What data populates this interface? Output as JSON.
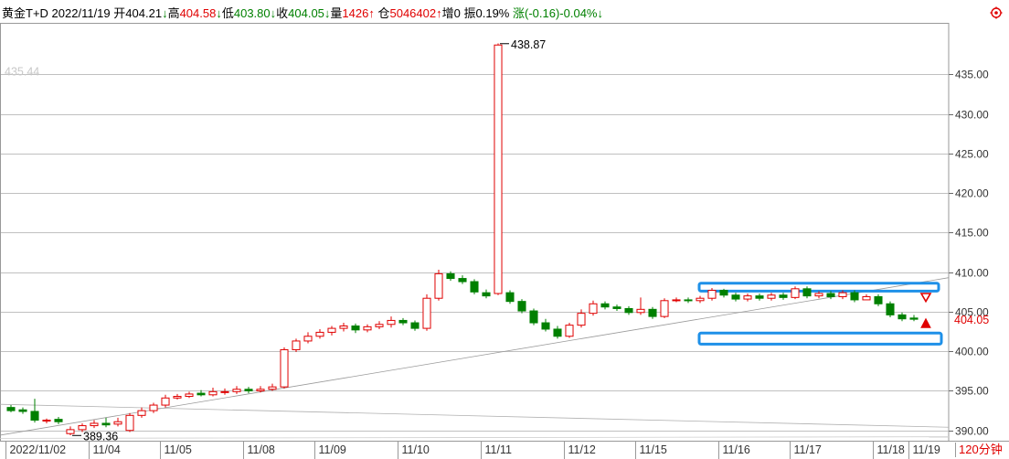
{
  "header": {
    "symbol": "黄金T+D",
    "date": "2022/11/19",
    "open_label": "开",
    "open": "404.21",
    "open_arrow": "↓",
    "high_label": "高",
    "high": "404.58",
    "high_arrow": "↓",
    "low_label": "低",
    "low": "403.80",
    "low_arrow": "↓",
    "close_label": "收",
    "close": "404.05",
    "close_arrow": "↓",
    "vol_label": "量",
    "vol": "1426",
    "vol_arrow": "↑",
    "oi_label": "仓",
    "oi": "5046402",
    "oi_arrow": "↑",
    "inc_label": "增",
    "inc": "0",
    "amp_label": "振",
    "amp": "0.19%",
    "chg_label": "涨",
    "chg": "(-0.16)-0.04%",
    "chg_arrow": "↓"
  },
  "period": "120分钟",
  "colors": {
    "up": "#e00000",
    "down": "#008000",
    "box": "#1e90e8",
    "grid": "#c0c0c0"
  },
  "icons": {
    "settings": "gear-icon",
    "sell_marker": "down-arrow-icon",
    "buy_marker": "up-arrow-icon"
  },
  "chart_data": {
    "type": "candlestick",
    "ylim": [
      388.7,
      441.5
    ],
    "y_ticks": [
      "390.00",
      "395.00",
      "400.00",
      "405.00",
      "410.00",
      "415.00",
      "420.00",
      "425.00",
      "430.00",
      "435.00"
    ],
    "last_price": "404.05",
    "view_high": "435.44",
    "x_labels": [
      "2022/11/02",
      "11/04",
      "11/05",
      "11/08",
      "11/09",
      "11/10",
      "11/11",
      "11/12",
      "11/15",
      "11/16",
      "11/17",
      "11/18",
      "11/19"
    ],
    "annotations": [
      {
        "text": "438.87",
        "at_index": 40
      },
      {
        "text": "389.36",
        "at_index": 5
      }
    ],
    "candles": [
      [
        392.9,
        392.5,
        393.2,
        392.3
      ],
      [
        392.6,
        392.4,
        392.9,
        392.1
      ],
      [
        392.4,
        391.3,
        394.0,
        391.0
      ],
      [
        391.2,
        391.3,
        391.5,
        390.9
      ],
      [
        391.4,
        391.1,
        391.7,
        390.8
      ],
      [
        389.6,
        390.1,
        390.5,
        389.4
      ],
      [
        390.1,
        390.6,
        390.9,
        389.8
      ],
      [
        390.6,
        390.9,
        391.3,
        390.3
      ],
      [
        390.9,
        390.7,
        391.6,
        390.4
      ],
      [
        390.8,
        391.1,
        391.6,
        390.5
      ],
      [
        390.0,
        391.9,
        392.2,
        389.8
      ],
      [
        391.9,
        392.5,
        392.9,
        391.6
      ],
      [
        392.5,
        393.2,
        393.5,
        392.2
      ],
      [
        393.2,
        394.1,
        394.5,
        392.9
      ],
      [
        394.1,
        394.3,
        394.6,
        393.9
      ],
      [
        394.3,
        394.6,
        394.9,
        394.1
      ],
      [
        394.7,
        394.5,
        395.1,
        394.3
      ],
      [
        394.5,
        394.9,
        395.4,
        394.3
      ],
      [
        394.9,
        394.9,
        395.3,
        394.5
      ],
      [
        394.9,
        395.2,
        395.6,
        394.6
      ],
      [
        395.2,
        395.0,
        395.5,
        394.7
      ],
      [
        395.0,
        395.2,
        395.6,
        394.8
      ],
      [
        395.2,
        395.5,
        395.9,
        395.0
      ],
      [
        395.5,
        400.2,
        400.5,
        395.3
      ],
      [
        400.2,
        401.3,
        401.6,
        399.9
      ],
      [
        401.3,
        401.9,
        402.4,
        401.0
      ],
      [
        401.9,
        402.4,
        402.8,
        401.6
      ],
      [
        402.4,
        402.9,
        403.2,
        402.0
      ],
      [
        402.9,
        403.2,
        403.6,
        402.5
      ],
      [
        403.2,
        402.7,
        403.5,
        402.3
      ],
      [
        402.7,
        403.1,
        403.4,
        402.4
      ],
      [
        403.1,
        403.4,
        403.8,
        402.8
      ],
      [
        403.4,
        403.9,
        404.4,
        403.0
      ],
      [
        403.9,
        403.6,
        404.2,
        403.3
      ],
      [
        403.6,
        402.9,
        403.9,
        402.6
      ],
      [
        402.9,
        406.7,
        407.2,
        402.6
      ],
      [
        406.7,
        409.8,
        410.3,
        406.4
      ],
      [
        409.8,
        409.2,
        410.1,
        408.9
      ],
      [
        409.2,
        408.8,
        409.6,
        408.5
      ],
      [
        408.8,
        407.5,
        409.1,
        407.2
      ],
      [
        407.4,
        407.0,
        407.8,
        406.7
      ],
      [
        407.3,
        438.7,
        438.9,
        407.1
      ],
      [
        407.4,
        406.3,
        407.7,
        406.0
      ],
      [
        406.3,
        405.1,
        406.6,
        404.8
      ],
      [
        405.1,
        403.6,
        405.4,
        403.3
      ],
      [
        403.6,
        402.8,
        404.1,
        402.5
      ],
      [
        402.8,
        401.9,
        403.2,
        401.6
      ],
      [
        401.9,
        403.3,
        403.6,
        401.7
      ],
      [
        403.3,
        404.8,
        405.3,
        403.0
      ],
      [
        404.8,
        406.0,
        406.4,
        404.5
      ],
      [
        406.0,
        405.6,
        406.3,
        405.3
      ],
      [
        405.6,
        405.4,
        405.9,
        405.1
      ],
      [
        405.4,
        404.9,
        405.7,
        404.6
      ],
      [
        404.9,
        405.3,
        406.8,
        404.6
      ],
      [
        405.3,
        404.4,
        405.6,
        404.1
      ],
      [
        404.4,
        406.4,
        406.7,
        404.2
      ],
      [
        406.4,
        406.5,
        406.8,
        406.2
      ],
      [
        406.5,
        406.4,
        406.8,
        406.1
      ],
      [
        406.4,
        406.7,
        407.0,
        406.1
      ],
      [
        406.7,
        407.7,
        408.0,
        406.4
      ],
      [
        407.7,
        407.1,
        407.9,
        406.8
      ],
      [
        407.1,
        406.6,
        407.4,
        406.3
      ],
      [
        406.6,
        407.0,
        407.3,
        406.3
      ],
      [
        407.0,
        406.7,
        407.3,
        406.4
      ],
      [
        406.7,
        407.1,
        407.4,
        406.4
      ],
      [
        407.1,
        406.8,
        407.4,
        406.5
      ],
      [
        406.8,
        407.9,
        408.2,
        406.6
      ],
      [
        407.9,
        407.0,
        408.2,
        406.7
      ],
      [
        407.0,
        407.3,
        407.6,
        406.7
      ],
      [
        407.3,
        406.9,
        407.6,
        406.6
      ],
      [
        406.9,
        407.4,
        407.7,
        406.6
      ],
      [
        407.4,
        406.5,
        407.7,
        406.2
      ],
      [
        406.5,
        406.9,
        407.2,
        406.6
      ],
      [
        406.9,
        406.0,
        407.2,
        405.7
      ],
      [
        406.0,
        404.6,
        406.3,
        404.3
      ],
      [
        404.6,
        404.1,
        404.9,
        403.8
      ],
      [
        404.2,
        404.05,
        404.58,
        403.8
      ]
    ]
  }
}
